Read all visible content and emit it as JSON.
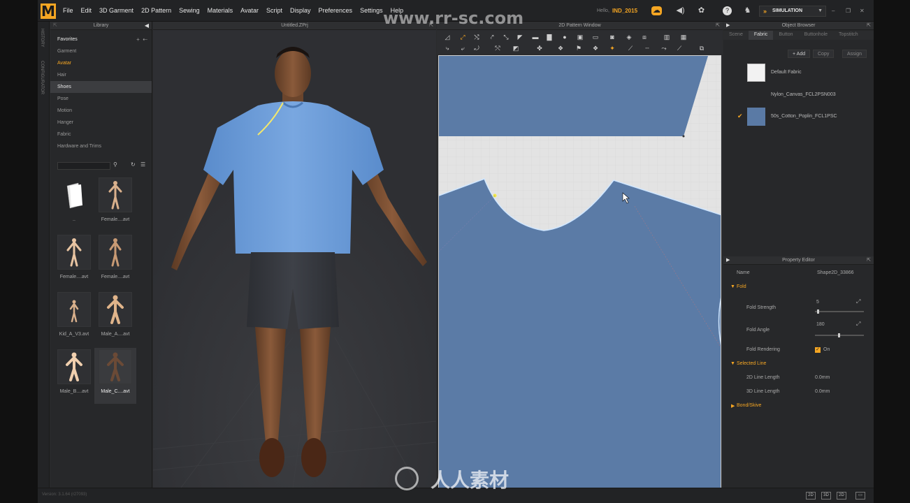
{
  "menubar": {
    "logo": "M",
    "items": [
      "File",
      "Edit",
      "3D Garment",
      "2D Pattern",
      "Sewing",
      "Materials",
      "Avatar",
      "Script",
      "Display",
      "Preferences",
      "Settings",
      "Help"
    ],
    "hello_label": "Hello,",
    "username": "IND_2015",
    "simulation_label": "SIMULATION"
  },
  "side_strip": {
    "history": "HISTORY",
    "configurator": "CONFIGURATOR"
  },
  "library": {
    "title": "Library",
    "categories": [
      {
        "label": "Favorites"
      },
      {
        "label": "Garment"
      },
      {
        "label": "Avatar"
      },
      {
        "label": "Hair"
      },
      {
        "label": "Shoes"
      },
      {
        "label": "Pose"
      },
      {
        "label": "Motion"
      },
      {
        "label": "Hanger"
      },
      {
        "label": "Fabric"
      },
      {
        "label": "Hardware and Trims"
      }
    ],
    "thumbnails": [
      {
        "label": ".."
      },
      {
        "label": "Female....avt"
      },
      {
        "label": "Female....avt"
      },
      {
        "label": "Female....avt"
      },
      {
        "label": "Kid_A_V3.avt"
      },
      {
        "label": "Male_A....avt"
      },
      {
        "label": "Male_B....avt"
      },
      {
        "label": "Male_C....avt"
      }
    ]
  },
  "view3d": {
    "title": "Untitled.ZPrj"
  },
  "view2d": {
    "title": "2D Pattern Window"
  },
  "object_browser": {
    "title": "Object Browser",
    "tabs": [
      "Scene",
      "Fabric",
      "Button",
      "Buttonhole",
      "Topstitch"
    ],
    "active_tab": "Fabric",
    "add_label": "+ Add",
    "copy_label": "Copy",
    "assign_label": "Assign",
    "fabrics": [
      {
        "name": "Default Fabric",
        "color": "#f2f2f2",
        "checked": false
      },
      {
        "name": "Nylon_Canvas_FCL2PSN003",
        "color": "#27282a",
        "checked": false
      },
      {
        "name": "50s_Cotton_Poplin_FCL1PSC",
        "color": "#5a7aa5",
        "checked": true
      }
    ]
  },
  "property_editor": {
    "title": "Property Editor",
    "name_label": "Name",
    "name_value": "Shape2D_33866",
    "fold_section": "Fold",
    "fold_strength_label": "Fold Strength",
    "fold_strength_value": "5",
    "fold_angle_label": "Fold Angle",
    "fold_angle_value": "180",
    "fold_rendering_label": "Fold Rendering",
    "fold_rendering_value": "On",
    "selected_line_section": "Selected Line",
    "line2d_label": "2D Line Length",
    "line2d_value": "0.0mm",
    "line3d_label": "3D Line Length",
    "line3d_value": "0.0mm",
    "bond_section": "Bond/Skive"
  },
  "statusbar": {
    "version": "Version: 3.1.64    (r27093)",
    "modes": [
      "2D",
      "3D",
      "2D"
    ]
  },
  "watermarks": {
    "url": "www.rr-sc.com",
    "brand": "人人素材"
  },
  "colors": {
    "accent": "#f5a623",
    "fabric_blue": "#5a7aa5",
    "shirt_blue": "#6a9ad6"
  }
}
